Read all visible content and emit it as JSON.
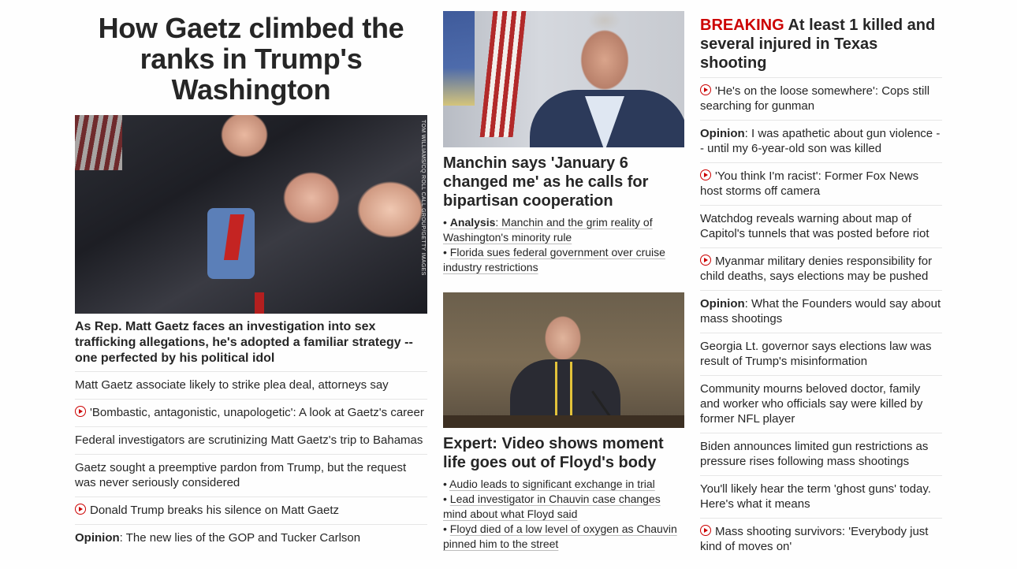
{
  "left": {
    "headline": "How Gaetz climbed the ranks in Trump's Washington",
    "photo_credit": "TOM WILLIAMS/CQ ROLL CALL GROUP/GETTY IMAGES",
    "subheadline": "As Rep. Matt Gaetz faces an investigation into sex trafficking allegations, he's adopted a familiar strategy -- one perfected by his political idol",
    "items": [
      {
        "text": "Matt Gaetz associate likely to strike plea deal, attorneys say"
      },
      {
        "text": "'Bombastic, antagonistic, unapologetic': A look at Gaetz's career"
      },
      {
        "text": "Federal investigators are scrutinizing Matt Gaetz's trip to Bahamas"
      },
      {
        "text": "Gaetz sought a preemptive pardon from Trump, but the request was never seriously considered"
      },
      {
        "text": "Donald Trump breaks his silence on Matt Gaetz"
      },
      {
        "label": "Opinion",
        "text": ": The new lies of the GOP and Tucker Carlson"
      }
    ]
  },
  "middle": {
    "story1": {
      "headline": "Manchin says 'January 6 changed me' as he calls for bipartisan cooperation",
      "bullets": [
        {
          "label": "Analysis",
          "text": ": Manchin and the grim reality of Washington's minority rule"
        },
        {
          "text": "Florida sues federal government over cruise industry restrictions"
        }
      ]
    },
    "story2": {
      "headline": "Expert: Video shows moment life goes out of Floyd's body",
      "bullets": [
        {
          "text": "Audio leads to significant exchange in trial"
        },
        {
          "text": "Lead investigator in Chauvin case changes mind about what Floyd said"
        },
        {
          "text": "Floyd died of a low level of oxygen as Chauvin pinned him to the street"
        }
      ]
    }
  },
  "right": {
    "breaking_tag": "BREAKING",
    "breaking_headline": " At least 1 killed and several injured in Texas shooting",
    "items": [
      {
        "text": "'He's on the loose somewhere': Cops still searching for gunman"
      },
      {
        "label": "Opinion",
        "text": ": I was apathetic about gun violence -- until my 6-year-old son was killed"
      },
      {
        "text": "'You think I'm racist': Former Fox News host storms off camera"
      },
      {
        "text": "Watchdog reveals warning about map of Capitol's tunnels that was posted before riot"
      },
      {
        "text": "Myanmar military denies responsibility for child deaths, says elections may be pushed"
      },
      {
        "label": "Opinion",
        "text": ": What the Founders would say about mass shootings"
      },
      {
        "text": "Georgia Lt. governor says elections law was result of Trump's misinformation"
      },
      {
        "text": "Community mourns beloved doctor, family and worker who officials say were killed by former NFL player"
      },
      {
        "text": "Biden announces limited gun restrictions as pressure rises following mass shootings"
      },
      {
        "text": "You'll likely hear the term 'ghost guns' today. Here's what it means"
      },
      {
        "text": "Mass shooting survivors: 'Everybody just kind of moves on'"
      }
    ]
  },
  "icons": {
    "video": "play-circle-icon"
  },
  "colors": {
    "breaking": "#cc0000",
    "text": "#262626",
    "divider": "#e6e6e6"
  }
}
